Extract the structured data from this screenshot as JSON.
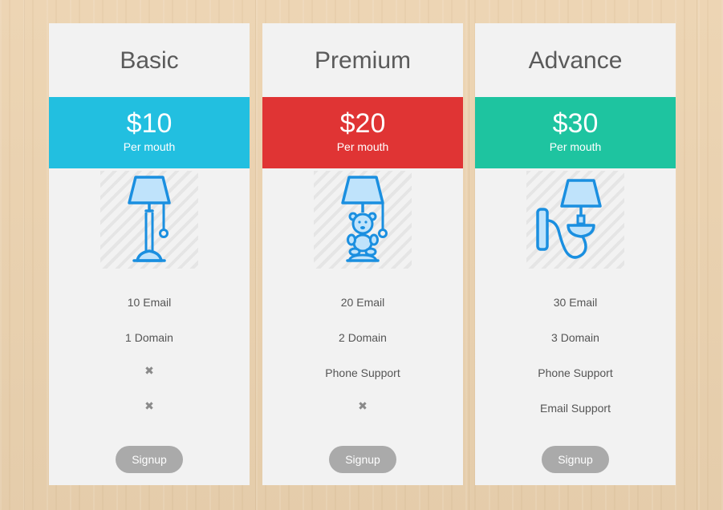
{
  "plans": [
    {
      "title": "Basic",
      "price": "$10",
      "period": "Per mouth",
      "band_color": "#22bfe0",
      "icon": "floor-lamp-icon",
      "features": [
        "10 Email",
        "1 Domain",
        "✖",
        "✖"
      ],
      "signup_label": "Signup"
    },
    {
      "title": "Premium",
      "price": "$20",
      "period": "Per mouth",
      "band_color": "#e03434",
      "icon": "teddy-bear-lamp-icon",
      "features": [
        "20 Email",
        "2 Domain",
        "Phone Support",
        "✖"
      ],
      "signup_label": "Signup"
    },
    {
      "title": "Advance",
      "price": "$30",
      "period": "Per mouth",
      "band_color": "#1ec4a0",
      "icon": "wall-lamp-icon",
      "features": [
        "30 Email",
        "3 Domain",
        "Phone Support",
        "Email Support"
      ],
      "signup_label": "Signup"
    }
  ],
  "colors": {
    "icon_stroke": "#1a8fe0",
    "icon_fill": "#bfe3fb",
    "button": "#aaaaaa",
    "card": "#f2f2f2"
  }
}
